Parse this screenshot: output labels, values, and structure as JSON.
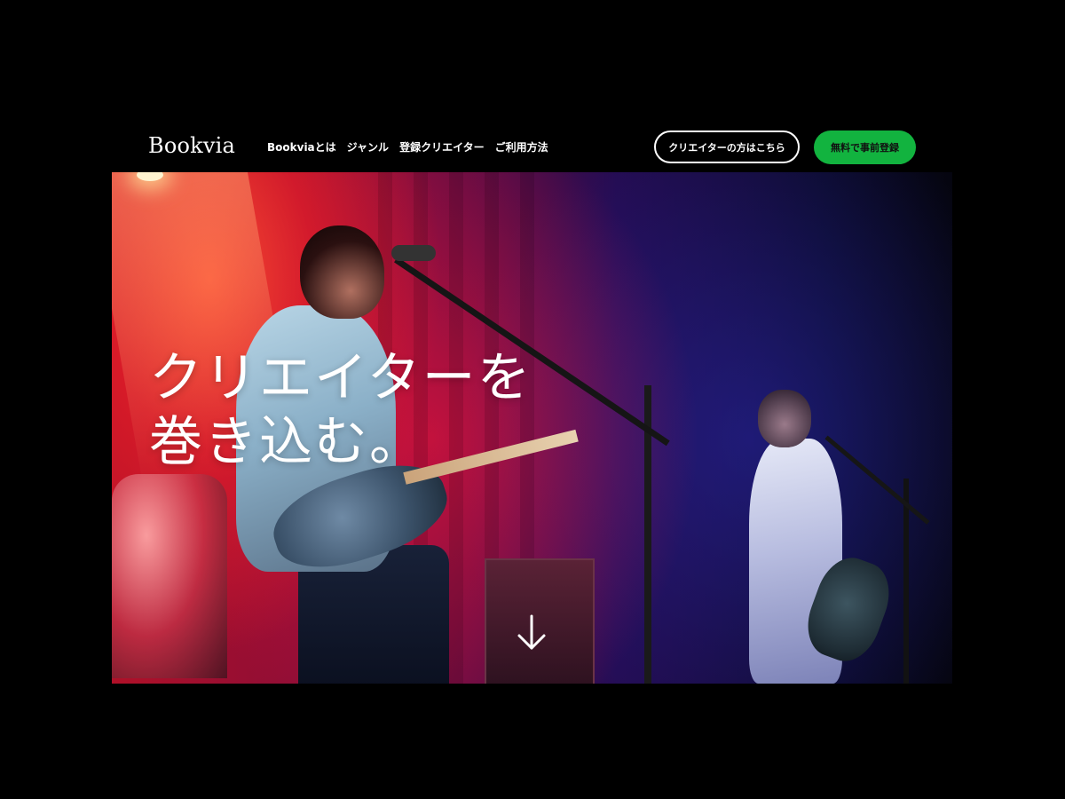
{
  "header": {
    "logo": "Bookvia",
    "nav": [
      {
        "label": "Bookviaとは"
      },
      {
        "label": "ジャンル"
      },
      {
        "label": "登録クリエイター"
      },
      {
        "label": "ご利用方法"
      }
    ],
    "creator_button": "クリエイターの方はこちら",
    "register_button": "無料で事前登録"
  },
  "hero": {
    "headline_line1": "クリエイターを",
    "headline_line2": "巻き込む。",
    "scroll_icon": "arrow-down-icon"
  },
  "colors": {
    "page_background": "#000000",
    "accent_green": "#12b33f",
    "text_white": "#ffffff"
  }
}
